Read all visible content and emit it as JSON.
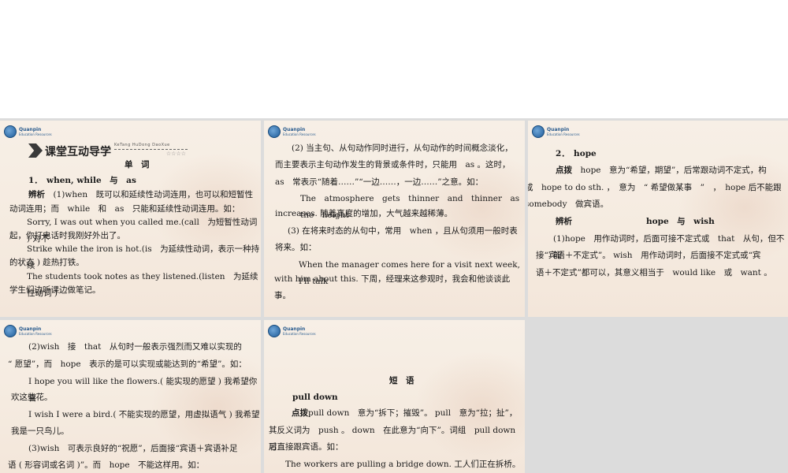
{
  "logo": {
    "brand": "Quanpin",
    "sub": "Education Resources"
  },
  "slide1": {
    "banner_title": "课堂互动导学",
    "banner_pinyin": "KeTang HuDong DaoXue",
    "banner_stars": "☆☆☆☆",
    "heading": "单　词",
    "item_title": "1．　when, while　与　as",
    "analysis_label": "辨析",
    "lines": [
      "　(1)when　既可以和延续性动词连用，也可以和短暂性",
      "动词连用；而　while　和　as　只能和延续性动词连用。如：",
      "Sorry, I was out when you called me.(call　为短暂性动词 ) 对不",
      "起，你打电话时我刚好外出了。",
      "Strike while the iron is hot.(is　为延续性动词，表示一种持续",
      "的状态 ) 趁热打铁。",
      "The students took notes as they listened.(listen　为延续性动词 )",
      "学生们边听课边做笔记。"
    ]
  },
  "slide2": {
    "lines": [
      "(2) 当主句、从句动作同时进行，从句动作的时间概念淡化，",
      "而主要表示主句动作发生的背景或条件时，只能用　as 。这时，",
      "as　常表示“随着……”“一边……，一边……”之意。如：",
      "The　atmosphere　gets　thinner　and　thinner　as　the　height",
      "increases. 随着高度的增加，大气越来越稀薄。",
      "(3) 在将来时态的从句中，常用　when ，且从句须用一般时表",
      "将来。如：",
      "When the manager comes here for a visit next week, I'll talk",
      "with him about this. 下周，经理来这参观时，我会和他谈谈此事。"
    ]
  },
  "slide3": {
    "item_title": "2．　hope",
    "tip_label": "点拨",
    "lines": [
      "　hope　意为“希望，期望”，后常跟动词不定式，构",
      "成　hope to do sth. ，　意为　“ 希望做某事　”　，　hope 后不能跟",
      "somebody　做宾语。"
    ],
    "analysis_label": "辨析",
    "analysis_topic": "hope　与　wish",
    "lines2": [
      "(1)hope　用作动词时，后面可接不定式或　that　从句，但不能",
      "接“宾语＋不定式”。 wish　用作动词时，后面接不定式或“宾",
      "语＋不定式”都可以，其意义相当于　would like　或　want 。"
    ]
  },
  "slide4": {
    "lines": [
      "(2)wish　接　that　从句时一般表示强烈而又难以实现的",
      "“ 愿望”，而　hope　表示的是可以实现或能达到的“希望”。如：",
      "I hope you will like the flowers.( 能实现的愿望 ) 我希望你喜",
      "欢这些花。",
      "I wish I were a bird.( 不能实现的愿望，用虚拟语气 ) 我希望",
      "我是一只鸟儿。",
      "(3)wish　可表示良好的“祝愿”，后面接“宾语＋宾语补足",
      "语 ( 形容词或名词 )”。而　hope　不能这样用。如："
    ]
  },
  "slide5": {
    "heading": "短　语",
    "item_title": "pull down",
    "tip_label": "点拨",
    "lines": [
      "pull down　意为“拆下；摧毁”。 pull　意为“拉；扯”，",
      "其反义词为　push 。 down　在此意为“向下”。词组　pull down　后",
      "可直接跟宾语。如：",
      "The workers are pulling a bridge down. 工人们正在拆桥。"
    ]
  }
}
